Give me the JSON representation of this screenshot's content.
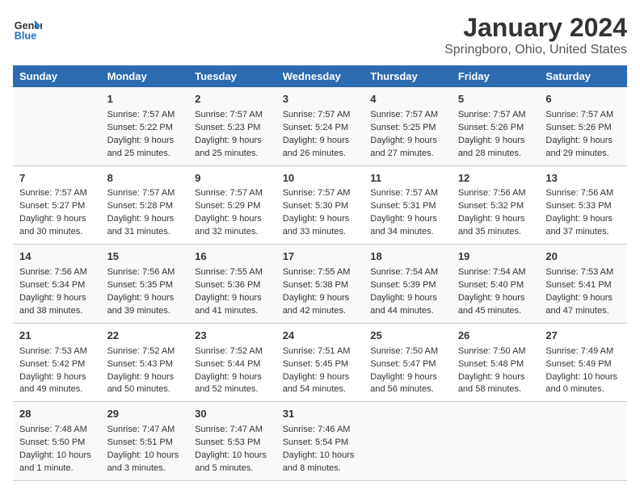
{
  "logo": {
    "line1": "General",
    "line2": "Blue"
  },
  "title": "January 2024",
  "subtitle": "Springboro, Ohio, United States",
  "days_of_week": [
    "Sunday",
    "Monday",
    "Tuesday",
    "Wednesday",
    "Thursday",
    "Friday",
    "Saturday"
  ],
  "weeks": [
    [
      {
        "day": "",
        "sunrise": "",
        "sunset": "",
        "daylight": ""
      },
      {
        "day": "1",
        "sunrise": "Sunrise: 7:57 AM",
        "sunset": "Sunset: 5:22 PM",
        "daylight": "Daylight: 9 hours and 25 minutes."
      },
      {
        "day": "2",
        "sunrise": "Sunrise: 7:57 AM",
        "sunset": "Sunset: 5:23 PM",
        "daylight": "Daylight: 9 hours and 25 minutes."
      },
      {
        "day": "3",
        "sunrise": "Sunrise: 7:57 AM",
        "sunset": "Sunset: 5:24 PM",
        "daylight": "Daylight: 9 hours and 26 minutes."
      },
      {
        "day": "4",
        "sunrise": "Sunrise: 7:57 AM",
        "sunset": "Sunset: 5:25 PM",
        "daylight": "Daylight: 9 hours and 27 minutes."
      },
      {
        "day": "5",
        "sunrise": "Sunrise: 7:57 AM",
        "sunset": "Sunset: 5:26 PM",
        "daylight": "Daylight: 9 hours and 28 minutes."
      },
      {
        "day": "6",
        "sunrise": "Sunrise: 7:57 AM",
        "sunset": "Sunset: 5:26 PM",
        "daylight": "Daylight: 9 hours and 29 minutes."
      }
    ],
    [
      {
        "day": "7",
        "sunrise": "Sunrise: 7:57 AM",
        "sunset": "Sunset: 5:27 PM",
        "daylight": "Daylight: 9 hours and 30 minutes."
      },
      {
        "day": "8",
        "sunrise": "Sunrise: 7:57 AM",
        "sunset": "Sunset: 5:28 PM",
        "daylight": "Daylight: 9 hours and 31 minutes."
      },
      {
        "day": "9",
        "sunrise": "Sunrise: 7:57 AM",
        "sunset": "Sunset: 5:29 PM",
        "daylight": "Daylight: 9 hours and 32 minutes."
      },
      {
        "day": "10",
        "sunrise": "Sunrise: 7:57 AM",
        "sunset": "Sunset: 5:30 PM",
        "daylight": "Daylight: 9 hours and 33 minutes."
      },
      {
        "day": "11",
        "sunrise": "Sunrise: 7:57 AM",
        "sunset": "Sunset: 5:31 PM",
        "daylight": "Daylight: 9 hours and 34 minutes."
      },
      {
        "day": "12",
        "sunrise": "Sunrise: 7:56 AM",
        "sunset": "Sunset: 5:32 PM",
        "daylight": "Daylight: 9 hours and 35 minutes."
      },
      {
        "day": "13",
        "sunrise": "Sunrise: 7:56 AM",
        "sunset": "Sunset: 5:33 PM",
        "daylight": "Daylight: 9 hours and 37 minutes."
      }
    ],
    [
      {
        "day": "14",
        "sunrise": "Sunrise: 7:56 AM",
        "sunset": "Sunset: 5:34 PM",
        "daylight": "Daylight: 9 hours and 38 minutes."
      },
      {
        "day": "15",
        "sunrise": "Sunrise: 7:56 AM",
        "sunset": "Sunset: 5:35 PM",
        "daylight": "Daylight: 9 hours and 39 minutes."
      },
      {
        "day": "16",
        "sunrise": "Sunrise: 7:55 AM",
        "sunset": "Sunset: 5:36 PM",
        "daylight": "Daylight: 9 hours and 41 minutes."
      },
      {
        "day": "17",
        "sunrise": "Sunrise: 7:55 AM",
        "sunset": "Sunset: 5:38 PM",
        "daylight": "Daylight: 9 hours and 42 minutes."
      },
      {
        "day": "18",
        "sunrise": "Sunrise: 7:54 AM",
        "sunset": "Sunset: 5:39 PM",
        "daylight": "Daylight: 9 hours and 44 minutes."
      },
      {
        "day": "19",
        "sunrise": "Sunrise: 7:54 AM",
        "sunset": "Sunset: 5:40 PM",
        "daylight": "Daylight: 9 hours and 45 minutes."
      },
      {
        "day": "20",
        "sunrise": "Sunrise: 7:53 AM",
        "sunset": "Sunset: 5:41 PM",
        "daylight": "Daylight: 9 hours and 47 minutes."
      }
    ],
    [
      {
        "day": "21",
        "sunrise": "Sunrise: 7:53 AM",
        "sunset": "Sunset: 5:42 PM",
        "daylight": "Daylight: 9 hours and 49 minutes."
      },
      {
        "day": "22",
        "sunrise": "Sunrise: 7:52 AM",
        "sunset": "Sunset: 5:43 PM",
        "daylight": "Daylight: 9 hours and 50 minutes."
      },
      {
        "day": "23",
        "sunrise": "Sunrise: 7:52 AM",
        "sunset": "Sunset: 5:44 PM",
        "daylight": "Daylight: 9 hours and 52 minutes."
      },
      {
        "day": "24",
        "sunrise": "Sunrise: 7:51 AM",
        "sunset": "Sunset: 5:45 PM",
        "daylight": "Daylight: 9 hours and 54 minutes."
      },
      {
        "day": "25",
        "sunrise": "Sunrise: 7:50 AM",
        "sunset": "Sunset: 5:47 PM",
        "daylight": "Daylight: 9 hours and 56 minutes."
      },
      {
        "day": "26",
        "sunrise": "Sunrise: 7:50 AM",
        "sunset": "Sunset: 5:48 PM",
        "daylight": "Daylight: 9 hours and 58 minutes."
      },
      {
        "day": "27",
        "sunrise": "Sunrise: 7:49 AM",
        "sunset": "Sunset: 5:49 PM",
        "daylight": "Daylight: 10 hours and 0 minutes."
      }
    ],
    [
      {
        "day": "28",
        "sunrise": "Sunrise: 7:48 AM",
        "sunset": "Sunset: 5:50 PM",
        "daylight": "Daylight: 10 hours and 1 minute."
      },
      {
        "day": "29",
        "sunrise": "Sunrise: 7:47 AM",
        "sunset": "Sunset: 5:51 PM",
        "daylight": "Daylight: 10 hours and 3 minutes."
      },
      {
        "day": "30",
        "sunrise": "Sunrise: 7:47 AM",
        "sunset": "Sunset: 5:53 PM",
        "daylight": "Daylight: 10 hours and 5 minutes."
      },
      {
        "day": "31",
        "sunrise": "Sunrise: 7:46 AM",
        "sunset": "Sunset: 5:54 PM",
        "daylight": "Daylight: 10 hours and 8 minutes."
      },
      {
        "day": "",
        "sunrise": "",
        "sunset": "",
        "daylight": ""
      },
      {
        "day": "",
        "sunrise": "",
        "sunset": "",
        "daylight": ""
      },
      {
        "day": "",
        "sunrise": "",
        "sunset": "",
        "daylight": ""
      }
    ]
  ]
}
